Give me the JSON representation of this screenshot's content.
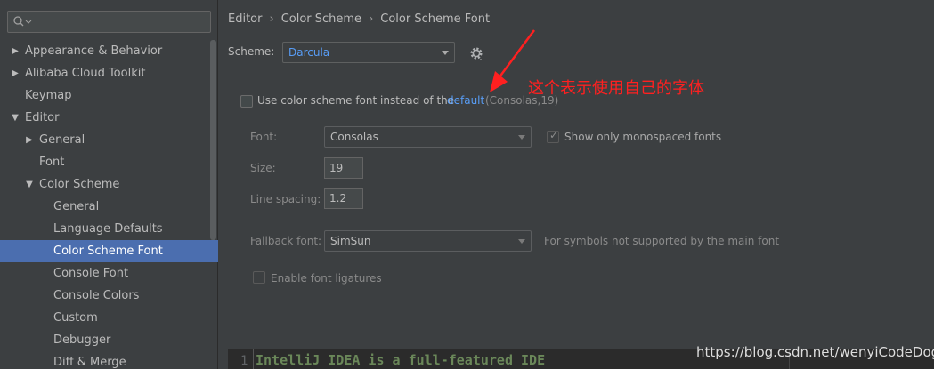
{
  "sidebar": {
    "search_placeholder": "",
    "items": [
      {
        "label": "Appearance & Behavior",
        "arrow": "▶"
      },
      {
        "label": "Alibaba Cloud Toolkit",
        "arrow": "▶"
      },
      {
        "label": "Keymap",
        "arrow": ""
      },
      {
        "label": "Editor",
        "arrow": "▼"
      },
      {
        "label": "General",
        "arrow": "▶"
      },
      {
        "label": "Font",
        "arrow": ""
      },
      {
        "label": "Color Scheme",
        "arrow": "▼"
      },
      {
        "label": "General",
        "arrow": ""
      },
      {
        "label": "Language Defaults",
        "arrow": ""
      },
      {
        "label": "Color Scheme Font",
        "arrow": ""
      },
      {
        "label": "Console Font",
        "arrow": ""
      },
      {
        "label": "Console Colors",
        "arrow": ""
      },
      {
        "label": "Custom",
        "arrow": ""
      },
      {
        "label": "Debugger",
        "arrow": ""
      },
      {
        "label": "Diff & Merge",
        "arrow": ""
      }
    ]
  },
  "breadcrumb": [
    "Editor",
    "Color Scheme",
    "Color Scheme Font"
  ],
  "breadcrumb_sep": "›",
  "scheme": {
    "label": "Scheme:",
    "value": "Darcula"
  },
  "annotation": "这个表示使用自己的字体",
  "use_scheme_font": {
    "label": "Use color scheme font instead of the",
    "link": "default",
    "hint": "(Consolas,19)"
  },
  "font": {
    "label": "Font:",
    "value": "Consolas"
  },
  "monospaced": {
    "label": "Show only monospaced fonts",
    "check": "✓"
  },
  "size": {
    "label": "Size:",
    "value": "19"
  },
  "line_spacing": {
    "label": "Line spacing:",
    "value": "1.2"
  },
  "fallback": {
    "label": "Fallback font:",
    "value": "SimSun",
    "hint": "For symbols not supported by the main font"
  },
  "ligatures": {
    "label": "Enable font ligatures"
  },
  "preview": {
    "line_number": "1",
    "code": "IntelliJ IDEA is a full-featured IDE"
  },
  "watermark": "https://blog.csdn.net/wenyiCodeDog",
  "colors": {
    "accent": "#4b6eaf",
    "link": "#589df6",
    "annotation": "#ff2020",
    "background": "#3c3f41"
  }
}
